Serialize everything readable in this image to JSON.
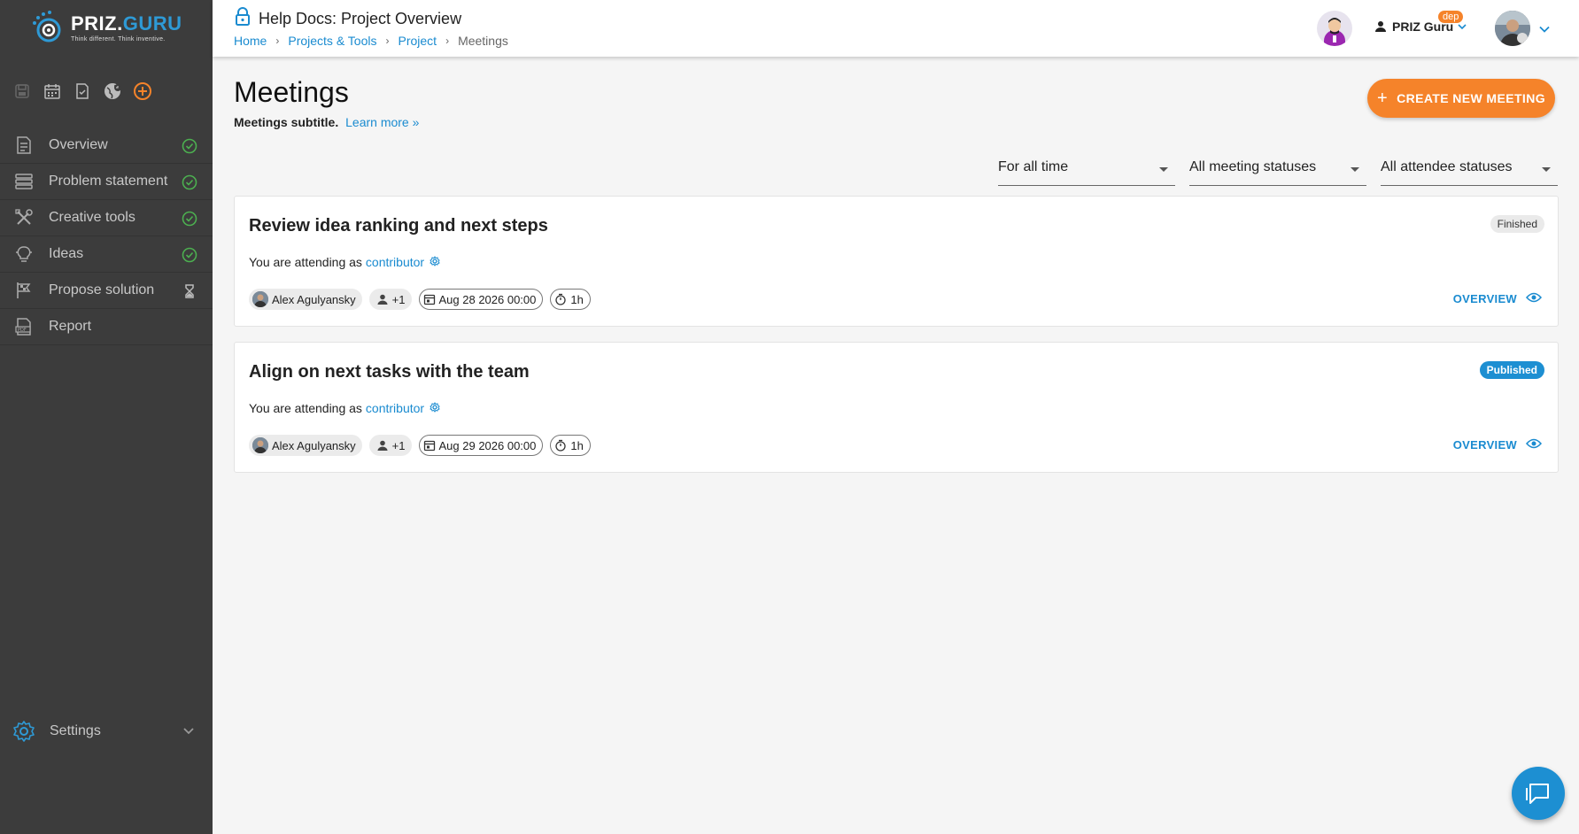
{
  "brand": {
    "name_part1": "PRIZ.",
    "name_part2": "GURU",
    "tagline": "Think different. Think inventive."
  },
  "sidebar": {
    "quick_icons": [
      "save-icon",
      "calendar-icon",
      "checklist-icon",
      "globe-icon",
      "add-circle-icon"
    ],
    "items": [
      {
        "label": "Overview",
        "icon": "document-icon",
        "status": "done"
      },
      {
        "label": "Problem statement",
        "icon": "layers-icon",
        "status": "done"
      },
      {
        "label": "Creative tools",
        "icon": "tools-icon",
        "status": "done"
      },
      {
        "label": "Ideas",
        "icon": "lightbulb-icon",
        "status": "done"
      },
      {
        "label": "Propose solution",
        "icon": "flag-icon",
        "status": "pending"
      },
      {
        "label": "Report",
        "icon": "pdf-icon",
        "status": ""
      }
    ],
    "settings_label": "Settings"
  },
  "topbar": {
    "title": "Help Docs: Project Overview",
    "breadcrumb": [
      "Home",
      "Projects & Tools",
      "Project",
      "Meetings"
    ],
    "user_name": "PRIZ Guru",
    "user_badge": "dep"
  },
  "page": {
    "title": "Meetings",
    "subtitle": "Meetings subtitle.",
    "learn_more": "Learn more »",
    "create_button": "CREATE NEW MEETING"
  },
  "filters": {
    "time": "For all time",
    "meeting_status": "All meeting statuses",
    "attendee_status": "All attendee statuses"
  },
  "meetings": [
    {
      "title": "Review idea ranking and next steps",
      "status": "Finished",
      "attending_prefix": "You are attending as",
      "role": "contributor",
      "organizer": "Alex Agulyansky",
      "extra_attendees": "+1",
      "date": "Aug 28 2026 00:00",
      "duration": "1h",
      "action": "OVERVIEW"
    },
    {
      "title": "Align on next tasks with the team",
      "status": "Published",
      "attending_prefix": "You are attending as",
      "role": "contributor",
      "organizer": "Alex Agulyansky",
      "extra_attendees": "+1",
      "date": "Aug 29 2026 00:00",
      "duration": "1h",
      "action": "OVERVIEW"
    }
  ],
  "colors": {
    "sidebar_bg": "#3c3c3c",
    "accent": "#f5832a",
    "link": "#1a8bd0",
    "check": "#4caf50"
  }
}
